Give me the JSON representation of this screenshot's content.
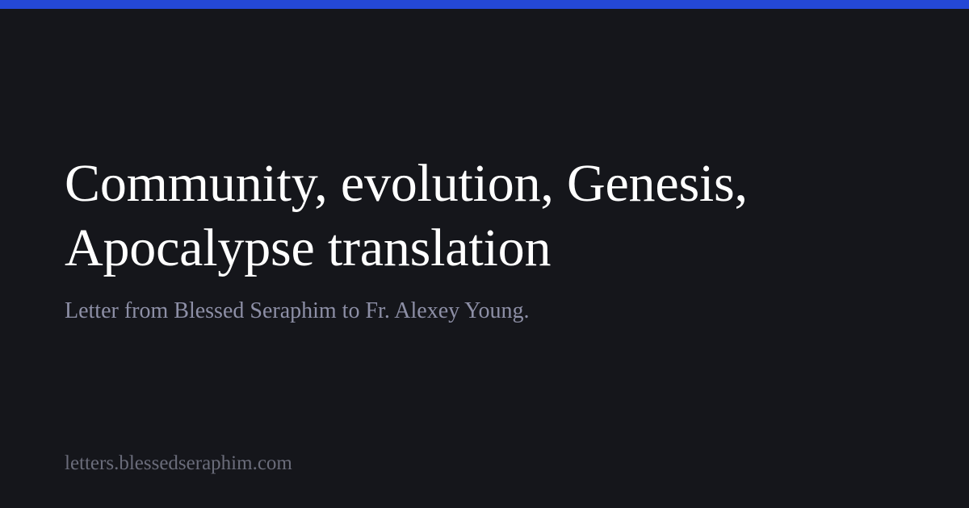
{
  "card": {
    "accent_color": "#2448d6",
    "background_color": "#15161b",
    "title": "Community, evolution, Genesis, Apocalypse translation",
    "subtitle": "Letter from Blessed Seraphim to Fr. Alexey Young.",
    "site_url": "letters.blessedseraphim.com"
  }
}
